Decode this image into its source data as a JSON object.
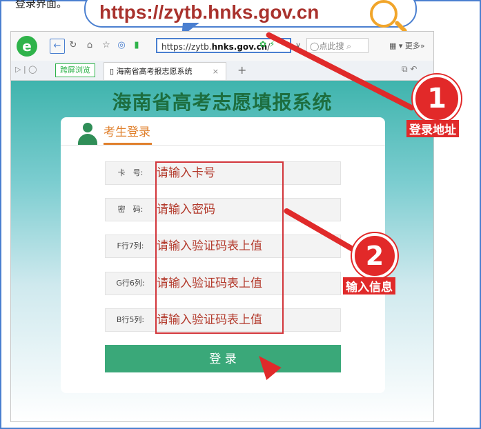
{
  "caption": "登录界面。",
  "url_callout": "https://zytb.hnks.gov.cn",
  "browser": {
    "logo": "e",
    "address_prefix": "https://zytb.",
    "address_domain": "hnks.gov.cn",
    "address_suffix": "/",
    "search_placeholder": "点此搜",
    "more_label": "更多»",
    "tab_cross_screen": "跨屏浏览",
    "tab_title": "海南省高考报志愿系统",
    "tab_close": "×",
    "new_tab": "+"
  },
  "page": {
    "title": "海南省高考志愿填报系统",
    "card_title": "考生登录",
    "fields": [
      {
        "label": "卡　号:",
        "placeholder": "请输入卡号"
      },
      {
        "label": "密　码:",
        "placeholder": "请输入密码"
      },
      {
        "label": "F行7列:",
        "placeholder": "请输入验证码表上值"
      },
      {
        "label": "G行6列:",
        "placeholder": "请输入验证码表上值"
      },
      {
        "label": "B行5列:",
        "placeholder": "请输入验证码表上值"
      }
    ],
    "login_button": "登 录"
  },
  "annotations": {
    "step1_number": "1",
    "step1_label": "登录地址",
    "step2_number": "2",
    "step2_label": "输入信息"
  },
  "colors": {
    "annotation_red": "#e02a2a",
    "title_green": "#1d6e3f",
    "button_green": "#3aa879",
    "accent_orange": "#e0802c"
  }
}
